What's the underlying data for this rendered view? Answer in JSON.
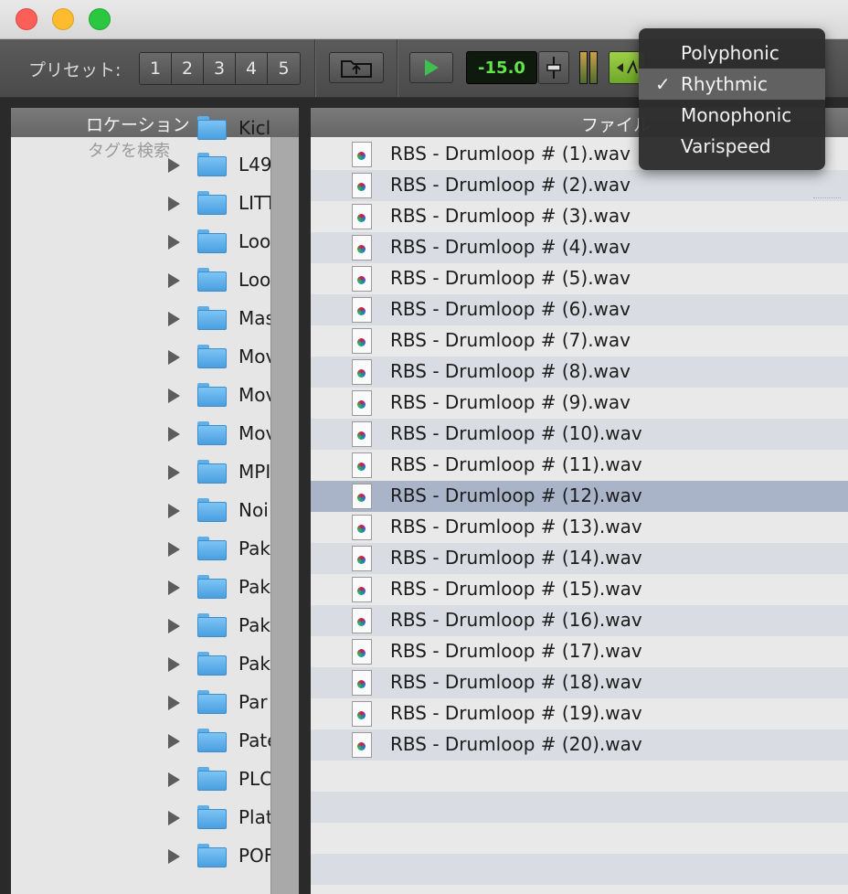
{
  "toolbar": {
    "preset_label": "プリセット:",
    "presets": [
      "1",
      "2",
      "3",
      "4",
      "5"
    ],
    "volume_value": "-15.0"
  },
  "menu": {
    "items": [
      {
        "label": "Polyphonic",
        "checked": false
      },
      {
        "label": "Rhythmic",
        "checked": true
      },
      {
        "label": "Monophonic",
        "checked": false
      },
      {
        "label": "Varispeed",
        "checked": false
      }
    ],
    "checkmark": "✓"
  },
  "left_panel": {
    "header": "ロケーション",
    "search_placeholder": "タグを検索",
    "folders": [
      "Kicl",
      "L49",
      "LITT",
      "Loo",
      "Loo",
      "Mas",
      "Mov",
      "Mov",
      "Mov",
      "MPI",
      "Noi",
      "Pak",
      "Pak",
      "Pak",
      "Pak",
      "Par",
      "Pate",
      "PLC",
      "Plat",
      "POF"
    ]
  },
  "right_panel": {
    "header": "ファイル",
    "files": [
      "RBS - Drumloop # (1).wav",
      "RBS - Drumloop # (2).wav",
      "RBS - Drumloop # (3).wav",
      "RBS - Drumloop # (4).wav",
      "RBS - Drumloop # (5).wav",
      "RBS - Drumloop # (6).wav",
      "RBS - Drumloop # (7).wav",
      "RBS - Drumloop # (8).wav",
      "RBS - Drumloop # (9).wav",
      "RBS - Drumloop # (10).wav",
      "RBS - Drumloop # (11).wav",
      "RBS - Drumloop # (12).wav",
      "RBS - Drumloop # (13).wav",
      "RBS - Drumloop # (14).wav",
      "RBS - Drumloop # (15).wav",
      "RBS - Drumloop # (16).wav",
      "RBS - Drumloop # (17).wav",
      "RBS - Drumloop # (18).wav",
      "RBS - Drumloop # (19).wav",
      "RBS - Drumloop # (20).wav"
    ],
    "selected_file": "RBS - Drumloop # (12).wav"
  },
  "colors": {
    "lcd_text": "#63e44a",
    "selected_row": "#a9b4c9",
    "folder_blue": "#5faee6",
    "play_green": "#3fbf4f",
    "mode_button": "#8cc63f"
  },
  "icons": {
    "titlebar": [
      "close-button",
      "minimize-button",
      "zoom-button"
    ],
    "toolbar": [
      "folder-upload-icon",
      "play-icon",
      "fader-icon",
      "level-meter",
      "playback-mode-icon"
    ]
  }
}
